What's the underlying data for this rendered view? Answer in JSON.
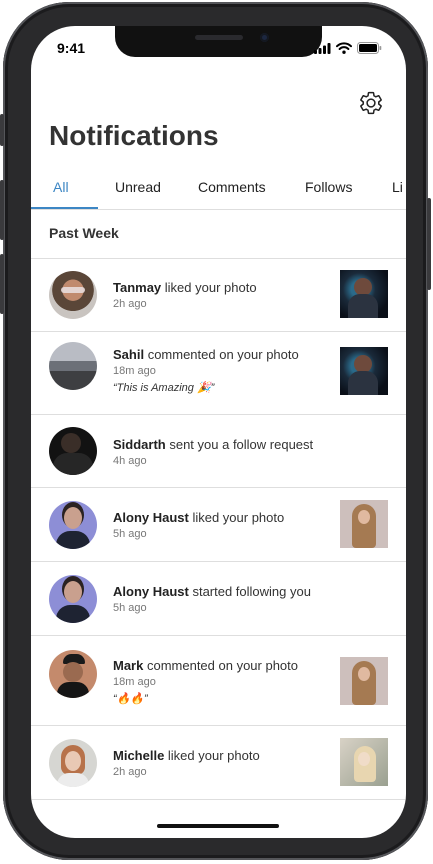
{
  "status_bar": {
    "time": "9:41"
  },
  "header": {
    "title": "Notifications"
  },
  "tabs": [
    {
      "label": "All"
    },
    {
      "label": "Unread"
    },
    {
      "label": "Comments"
    },
    {
      "label": "Follows"
    },
    {
      "label": "Li"
    }
  ],
  "section": {
    "title": "Past Week"
  },
  "notifications": [
    {
      "name": "Tanmay",
      "action": " liked your photo",
      "time": "2h ago"
    },
    {
      "name": "Sahil",
      "action": " commented on your photo",
      "time": "18m ago",
      "quote": "“This is Amazing 🎉”"
    },
    {
      "name": "Siddarth",
      "action": " sent you a follow request",
      "time": "4h ago"
    },
    {
      "name": "Alony Haust",
      "action": " liked your photo",
      "time": "5h ago"
    },
    {
      "name": "Alony Haust",
      "action": " started following you",
      "time": "5h ago"
    },
    {
      "name": "Mark",
      "action": " commented on your photo",
      "time": "18m ago",
      "quote": "“🔥🔥”"
    },
    {
      "name": "Michelle",
      "action": " liked your photo",
      "time": "2h ago"
    }
  ],
  "colors": {
    "accent": "#3c86c4",
    "divider": "#dedede"
  }
}
